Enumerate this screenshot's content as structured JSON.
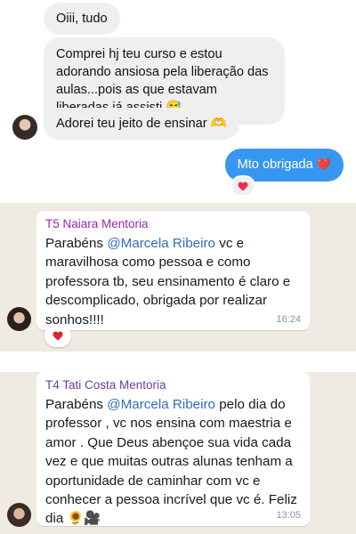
{
  "instagram": {
    "messages": [
      {
        "text": "Oiii, tudo"
      },
      {
        "text": "Comprei hj teu curso e estou adorando ansiosa pela liberação das aulas...pois as que estavam liberadas já assisti 😅"
      },
      {
        "text": "Adorei teu jeito de ensinar 🫶"
      }
    ],
    "sent": {
      "text": "Mto obrigada",
      "emoji": "❤️"
    },
    "reaction": "heart-icon",
    "colors": {
      "incoming": "#efefef",
      "outgoing": "#3797f0",
      "heart": "#ea2f4b"
    }
  },
  "whatsapp": [
    {
      "sender": "T5 Naiara Mentoria",
      "sender_color": "#9c27b0",
      "prefix": "Parabéns ",
      "mention": "@Marcela Ribeiro",
      "text": " vc e maravilhosa como pessoa e como professora tb, seu ensinamento é claro e descomplicado, obrigada por realizar sonhos!!!!",
      "time": "16:24",
      "reaction": "heart-icon"
    },
    {
      "sender": "T4 Tati Costa Mentoria",
      "sender_color": "#6a3fa0",
      "prefix": "Parabéns ",
      "mention": "@Marcela Ribeiro",
      "text": " pelo dia do professor , vc nos ensina com maestria e amor . Que Deus abençoe sua vida cada vez e que muitas outras alunas tenham a oportunidade de caminhar com vc e conhecer a pessoa incrível que vc é. Feliz dia 🌻🎥",
      "time": "13:05"
    }
  ]
}
